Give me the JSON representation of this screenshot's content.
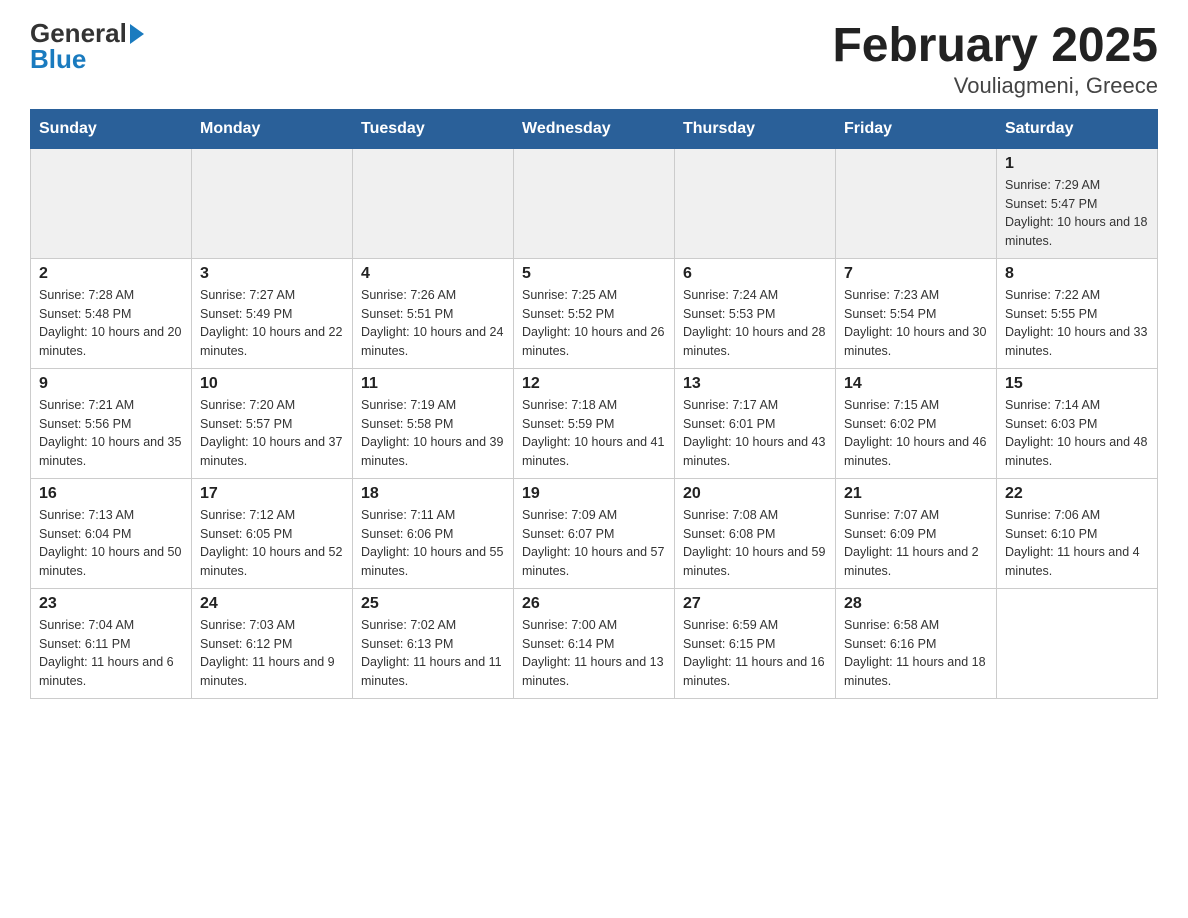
{
  "header": {
    "logo_general": "General",
    "logo_blue": "Blue",
    "title": "February 2025",
    "subtitle": "Vouliagmeni, Greece"
  },
  "days_of_week": [
    "Sunday",
    "Monday",
    "Tuesday",
    "Wednesday",
    "Thursday",
    "Friday",
    "Saturday"
  ],
  "weeks": [
    [
      {
        "day": "",
        "info": ""
      },
      {
        "day": "",
        "info": ""
      },
      {
        "day": "",
        "info": ""
      },
      {
        "day": "",
        "info": ""
      },
      {
        "day": "",
        "info": ""
      },
      {
        "day": "",
        "info": ""
      },
      {
        "day": "1",
        "info": "Sunrise: 7:29 AM\nSunset: 5:47 PM\nDaylight: 10 hours and 18 minutes."
      }
    ],
    [
      {
        "day": "2",
        "info": "Sunrise: 7:28 AM\nSunset: 5:48 PM\nDaylight: 10 hours and 20 minutes."
      },
      {
        "day": "3",
        "info": "Sunrise: 7:27 AM\nSunset: 5:49 PM\nDaylight: 10 hours and 22 minutes."
      },
      {
        "day": "4",
        "info": "Sunrise: 7:26 AM\nSunset: 5:51 PM\nDaylight: 10 hours and 24 minutes."
      },
      {
        "day": "5",
        "info": "Sunrise: 7:25 AM\nSunset: 5:52 PM\nDaylight: 10 hours and 26 minutes."
      },
      {
        "day": "6",
        "info": "Sunrise: 7:24 AM\nSunset: 5:53 PM\nDaylight: 10 hours and 28 minutes."
      },
      {
        "day": "7",
        "info": "Sunrise: 7:23 AM\nSunset: 5:54 PM\nDaylight: 10 hours and 30 minutes."
      },
      {
        "day": "8",
        "info": "Sunrise: 7:22 AM\nSunset: 5:55 PM\nDaylight: 10 hours and 33 minutes."
      }
    ],
    [
      {
        "day": "9",
        "info": "Sunrise: 7:21 AM\nSunset: 5:56 PM\nDaylight: 10 hours and 35 minutes."
      },
      {
        "day": "10",
        "info": "Sunrise: 7:20 AM\nSunset: 5:57 PM\nDaylight: 10 hours and 37 minutes."
      },
      {
        "day": "11",
        "info": "Sunrise: 7:19 AM\nSunset: 5:58 PM\nDaylight: 10 hours and 39 minutes."
      },
      {
        "day": "12",
        "info": "Sunrise: 7:18 AM\nSunset: 5:59 PM\nDaylight: 10 hours and 41 minutes."
      },
      {
        "day": "13",
        "info": "Sunrise: 7:17 AM\nSunset: 6:01 PM\nDaylight: 10 hours and 43 minutes."
      },
      {
        "day": "14",
        "info": "Sunrise: 7:15 AM\nSunset: 6:02 PM\nDaylight: 10 hours and 46 minutes."
      },
      {
        "day": "15",
        "info": "Sunrise: 7:14 AM\nSunset: 6:03 PM\nDaylight: 10 hours and 48 minutes."
      }
    ],
    [
      {
        "day": "16",
        "info": "Sunrise: 7:13 AM\nSunset: 6:04 PM\nDaylight: 10 hours and 50 minutes."
      },
      {
        "day": "17",
        "info": "Sunrise: 7:12 AM\nSunset: 6:05 PM\nDaylight: 10 hours and 52 minutes."
      },
      {
        "day": "18",
        "info": "Sunrise: 7:11 AM\nSunset: 6:06 PM\nDaylight: 10 hours and 55 minutes."
      },
      {
        "day": "19",
        "info": "Sunrise: 7:09 AM\nSunset: 6:07 PM\nDaylight: 10 hours and 57 minutes."
      },
      {
        "day": "20",
        "info": "Sunrise: 7:08 AM\nSunset: 6:08 PM\nDaylight: 10 hours and 59 minutes."
      },
      {
        "day": "21",
        "info": "Sunrise: 7:07 AM\nSunset: 6:09 PM\nDaylight: 11 hours and 2 minutes."
      },
      {
        "day": "22",
        "info": "Sunrise: 7:06 AM\nSunset: 6:10 PM\nDaylight: 11 hours and 4 minutes."
      }
    ],
    [
      {
        "day": "23",
        "info": "Sunrise: 7:04 AM\nSunset: 6:11 PM\nDaylight: 11 hours and 6 minutes."
      },
      {
        "day": "24",
        "info": "Sunrise: 7:03 AM\nSunset: 6:12 PM\nDaylight: 11 hours and 9 minutes."
      },
      {
        "day": "25",
        "info": "Sunrise: 7:02 AM\nSunset: 6:13 PM\nDaylight: 11 hours and 11 minutes."
      },
      {
        "day": "26",
        "info": "Sunrise: 7:00 AM\nSunset: 6:14 PM\nDaylight: 11 hours and 13 minutes."
      },
      {
        "day": "27",
        "info": "Sunrise: 6:59 AM\nSunset: 6:15 PM\nDaylight: 11 hours and 16 minutes."
      },
      {
        "day": "28",
        "info": "Sunrise: 6:58 AM\nSunset: 6:16 PM\nDaylight: 11 hours and 18 minutes."
      },
      {
        "day": "",
        "info": ""
      }
    ]
  ]
}
